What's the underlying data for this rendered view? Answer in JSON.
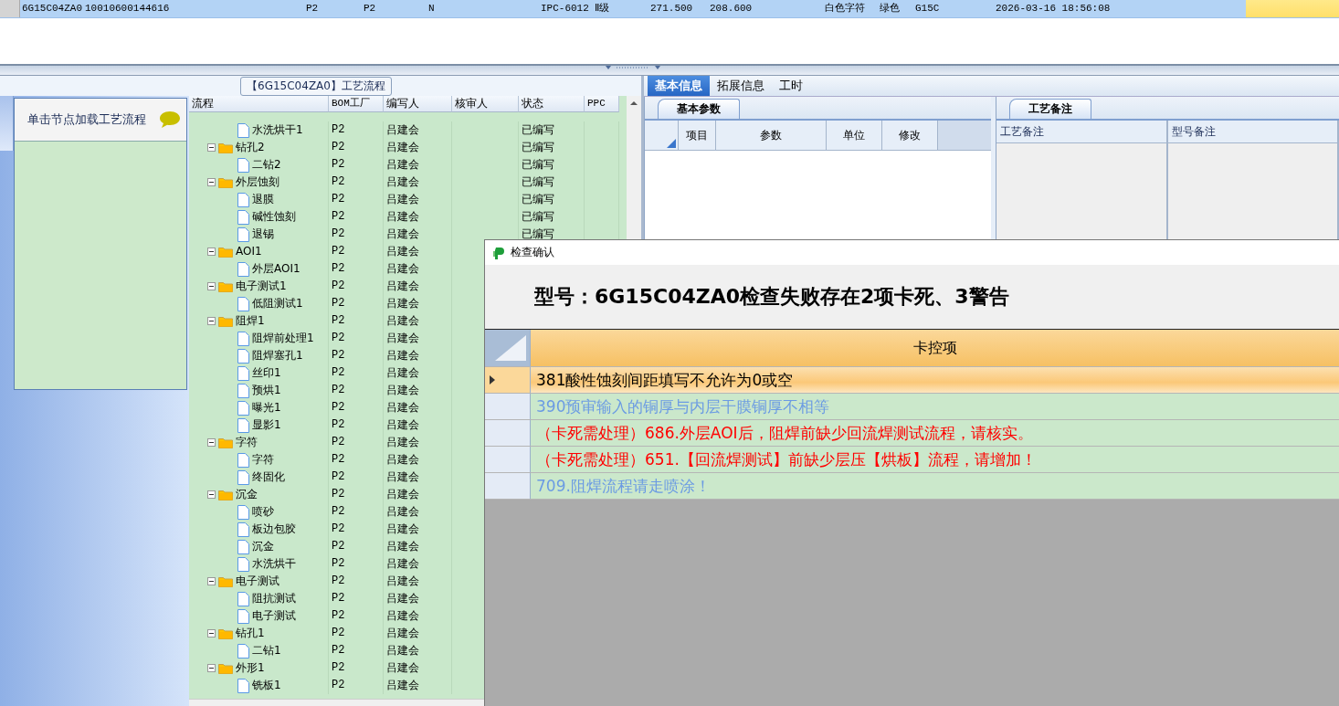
{
  "top_row": {
    "cells": [
      "6G15C04ZA0",
      "10010600144616",
      "P2",
      "P2",
      "N",
      "IPC-6012 Ⅱ级",
      "271.500",
      "208.600",
      "白色字符",
      "绿色",
      "G15C",
      "2026-03-16 18:56:08"
    ]
  },
  "flow_caption": "【6G15C04ZA0】工艺流程",
  "side_panel": {
    "hint": "单击节点加载工艺流程"
  },
  "flow_table": {
    "columns": [
      "流程",
      "BOM工厂",
      "编写人",
      "核审人",
      "状态",
      "PPC"
    ],
    "rows": [
      {
        "children": [
          {
            "label": "水洗烘干1",
            "bom": "P2",
            "author": "吕建会",
            "status": "已编写"
          }
        ]
      },
      {
        "label": "钻孔2",
        "bom": "P2",
        "author": "吕建会",
        "status": "已编写",
        "children": [
          {
            "label": "二钻2",
            "bom": "P2",
            "author": "吕建会",
            "status": "已编写"
          }
        ]
      },
      {
        "label": "外层蚀刻",
        "bom": "P2",
        "author": "吕建会",
        "status": "已编写",
        "children": [
          {
            "label": "退膜",
            "bom": "P2",
            "author": "吕建会",
            "status": "已编写"
          },
          {
            "label": "碱性蚀刻",
            "bom": "P2",
            "author": "吕建会",
            "status": "已编写"
          },
          {
            "label": "退锡",
            "bom": "P2",
            "author": "吕建会",
            "status": "已编写"
          }
        ]
      },
      {
        "label": "AOI1",
        "bom": "P2",
        "author": "吕建会",
        "children": [
          {
            "label": "外层AOI1",
            "bom": "P2",
            "author": "吕建会"
          }
        ]
      },
      {
        "label": "电子测试1",
        "bom": "P2",
        "author": "吕建会",
        "children": [
          {
            "label": "低阻测试1",
            "bom": "P2",
            "author": "吕建会"
          }
        ]
      },
      {
        "label": "阻焊1",
        "bom": "P2",
        "author": "吕建会",
        "children": [
          {
            "label": "阻焊前处理1",
            "bom": "P2",
            "author": "吕建会"
          },
          {
            "label": "阻焊塞孔1",
            "bom": "P2",
            "author": "吕建会"
          },
          {
            "label": "丝印1",
            "bom": "P2",
            "author": "吕建会"
          },
          {
            "label": "预烘1",
            "bom": "P2",
            "author": "吕建会"
          },
          {
            "label": "曝光1",
            "bom": "P2",
            "author": "吕建会"
          },
          {
            "label": "显影1",
            "bom": "P2",
            "author": "吕建会"
          }
        ]
      },
      {
        "label": "字符",
        "bom": "P2",
        "author": "吕建会",
        "children": [
          {
            "label": "字符",
            "bom": "P2",
            "author": "吕建会"
          },
          {
            "label": "终固化",
            "bom": "P2",
            "author": "吕建会"
          }
        ]
      },
      {
        "label": "沉金",
        "bom": "P2",
        "author": "吕建会",
        "children": [
          {
            "label": "喷砂",
            "bom": "P2",
            "author": "吕建会"
          },
          {
            "label": "板边包胶",
            "bom": "P2",
            "author": "吕建会"
          },
          {
            "label": "沉金",
            "bom": "P2",
            "author": "吕建会"
          },
          {
            "label": "水洗烘干",
            "bom": "P2",
            "author": "吕建会"
          }
        ]
      },
      {
        "label": "电子测试",
        "bom": "P2",
        "author": "吕建会",
        "children": [
          {
            "label": "阻抗测试",
            "bom": "P2",
            "author": "吕建会"
          },
          {
            "label": "电子测试",
            "bom": "P2",
            "author": "吕建会"
          }
        ]
      },
      {
        "label": "钻孔1",
        "bom": "P2",
        "author": "吕建会",
        "children": [
          {
            "label": "二钻1",
            "bom": "P2",
            "author": "吕建会"
          }
        ]
      },
      {
        "label": "外形1",
        "bom": "P2",
        "author": "吕建会",
        "children": [
          {
            "label": "铣板1",
            "bom": "P2",
            "author": "吕建会"
          }
        ]
      }
    ]
  },
  "detail_tabs": [
    {
      "label": "基本信息",
      "selected": true
    },
    {
      "label": "拓展信息",
      "selected": false
    },
    {
      "label": "工时",
      "selected": false
    }
  ],
  "basic_params": {
    "tab": "基本参数",
    "columns": [
      "项目",
      "参数",
      "单位",
      "修改"
    ]
  },
  "process_notes": {
    "tab": "工艺备注",
    "columns": [
      "工艺备注",
      "型号备注"
    ]
  },
  "dialog": {
    "title": "检查确认",
    "heading": "型号：6G15C04ZA0检查失败存在2项卡死、3警告",
    "column": "卡控项",
    "rows": [
      {
        "text": "381酸性蚀刻间距填写不允许为0或空",
        "color": "#000000",
        "selected": true
      },
      {
        "text": "390预审输入的铜厚与内层干膜铜厚不相等",
        "color": "#6b9be3",
        "selected": false
      },
      {
        "text": "（卡死需处理）686.外层AOI后，阻焊前缺少回流焊测试流程，请核实。",
        "color": "#ff0000",
        "selected": false
      },
      {
        "text": "（卡死需处理）651.【回流焊测试】前缺少层压【烘板】流程，请增加！",
        "color": "#ff0000",
        "selected": false
      },
      {
        "text": "709.阻焊流程请走喷涂！",
        "color": "#6b9be3",
        "selected": false
      }
    ]
  }
}
